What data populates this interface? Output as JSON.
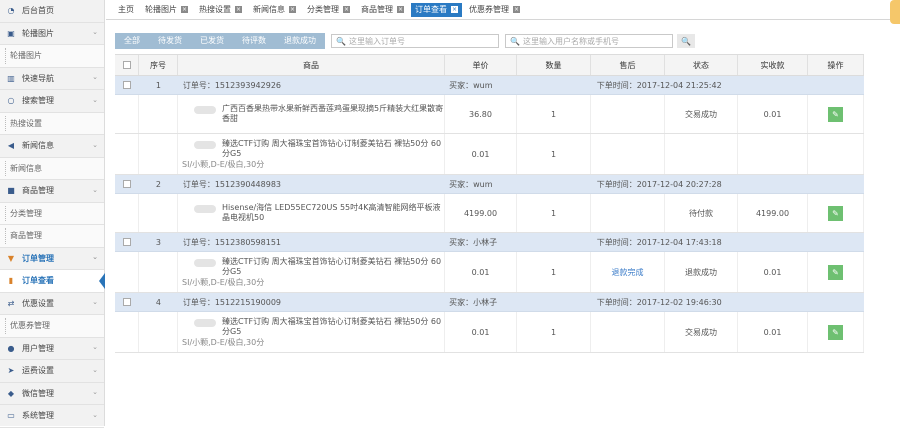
{
  "sidebar": {
    "items": [
      {
        "label": "后台首页",
        "icon": "dashboard-icon",
        "type": "group",
        "chevron": false
      },
      {
        "label": "轮播图片",
        "icon": "image-icon",
        "type": "group",
        "chevron": true
      },
      {
        "label": "轮播图片",
        "type": "sub"
      },
      {
        "label": "快速导航",
        "icon": "bars-icon",
        "type": "group",
        "chevron": true
      },
      {
        "label": "搜索管理",
        "icon": "search-circle-icon",
        "type": "group",
        "chevron": true
      },
      {
        "label": "热搜设置",
        "type": "sub"
      },
      {
        "label": "新闻信息",
        "icon": "megaphone-icon",
        "type": "group",
        "chevron": true
      },
      {
        "label": "新闻信息",
        "type": "sub"
      },
      {
        "label": "商品管理",
        "icon": "gift-icon",
        "type": "group",
        "chevron": true
      },
      {
        "label": "分类管理",
        "type": "sub"
      },
      {
        "label": "商品管理",
        "type": "sub"
      },
      {
        "label": "订单管理",
        "icon": "cart-icon",
        "type": "group-active",
        "chevron": true
      },
      {
        "label": "订单查看",
        "icon": "order-icon",
        "type": "sub-active"
      },
      {
        "label": "优惠设置",
        "icon": "exchange-icon",
        "type": "group",
        "chevron": true
      },
      {
        "label": "优惠券管理",
        "type": "sub"
      },
      {
        "label": "用户管理",
        "icon": "users-icon",
        "type": "group",
        "chevron": true
      },
      {
        "label": "运费设置",
        "icon": "plane-icon",
        "type": "group",
        "chevron": true
      },
      {
        "label": "微信管理",
        "icon": "chat-icon",
        "type": "group",
        "chevron": true
      },
      {
        "label": "系统管理",
        "icon": "monitor-icon",
        "type": "group",
        "chevron": true
      }
    ]
  },
  "tabs": [
    {
      "label": "主页",
      "closable": false,
      "active": false
    },
    {
      "label": "轮播图片",
      "closable": true,
      "active": false
    },
    {
      "label": "热搜设置",
      "closable": true,
      "active": false
    },
    {
      "label": "新闻信息",
      "closable": true,
      "active": false
    },
    {
      "label": "分类管理",
      "closable": true,
      "active": false
    },
    {
      "label": "商品管理",
      "closable": true,
      "active": false
    },
    {
      "label": "订单查看",
      "closable": true,
      "active": true
    },
    {
      "label": "优惠券管理",
      "closable": true,
      "active": false
    }
  ],
  "tab_close_glyph": "×",
  "filter": {
    "tabs": [
      "全部",
      "待发货",
      "已发货",
      "待评数",
      "退款成功"
    ],
    "order_search_placeholder": "这里输入订单号",
    "user_search_placeholder": "这里输入用户名称或手机号",
    "search_glyph": "🔍"
  },
  "table": {
    "headers": [
      "序号",
      "商品",
      "单价",
      "数量",
      "售后",
      "状态",
      "实收款",
      "操作"
    ],
    "orders": [
      {
        "index": "1",
        "order_no": "订单号：1512393942926",
        "buyer": "买家：wum",
        "time": "下单时间：2017-12-04 21:25:42",
        "items": [
          {
            "name": "广西百香果热带水果新鲜西番莲鸡蛋果现摘5斤精装大红果散寄香甜",
            "sku": "",
            "price": "36.80",
            "qty": "1",
            "after_sale": "",
            "status": "交易成功",
            "paid": "0.01",
            "edit": true
          },
          {
            "name": "臻选CTF订购 周大福珠宝首饰钻心订制菱美钻石 裸钻50分 60分G5",
            "sku": "SI/小颗,D-E/极白,30分",
            "price": "0.01",
            "qty": "1",
            "after_sale": "",
            "status": "",
            "paid": "",
            "edit": false
          }
        ]
      },
      {
        "index": "2",
        "order_no": "订单号：1512390448983",
        "buyer": "买家：wum",
        "time": "下单时间：2017-12-04 20:27:28",
        "items": [
          {
            "name": "Hisense/海信 LED55EC720US 55吋4K高清智能网络平板液晶电视机50",
            "sku": "",
            "price": "4199.00",
            "qty": "1",
            "after_sale": "",
            "status": "待付款",
            "paid": "4199.00",
            "edit": true
          }
        ]
      },
      {
        "index": "3",
        "order_no": "订单号：1512380598151",
        "buyer": "买家：小林子",
        "time": "下单时间：2017-12-04 17:43:18",
        "items": [
          {
            "name": "臻选CTF订购 周大福珠宝首饰钻心订制菱美钻石 裸钻50分 60分G5",
            "sku": "SI/小颗,D-E/极白,30分",
            "price": "0.01",
            "qty": "1",
            "after_sale": "退款完成",
            "status": "退款成功",
            "paid": "0.01",
            "edit": true
          }
        ]
      },
      {
        "index": "4",
        "order_no": "订单号：1512215190009",
        "buyer": "买家：小林子",
        "time": "下单时间：2017-12-02 19:46:30",
        "items": [
          {
            "name": "臻选CTF订购 周大福珠宝首饰钻心订制菱美钻石 裸钻50分 60分G5",
            "sku": "SI/小颗,D-E/极白,30分",
            "price": "0.01",
            "qty": "1",
            "after_sale": "",
            "status": "交易成功",
            "paid": "0.01",
            "edit": true
          }
        ]
      }
    ]
  },
  "colors": {
    "accent": "#2a74b8",
    "order_row_bg": "#dde7f4",
    "edit_button": "#6ec071",
    "filter_bar": "#a0bcd3"
  }
}
